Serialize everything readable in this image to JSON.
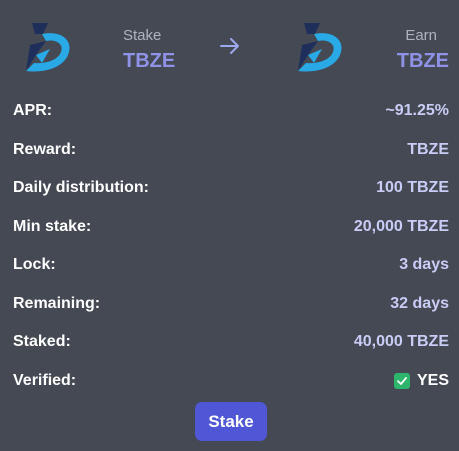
{
  "header": {
    "stake": {
      "label": "Stake",
      "symbol": "TBZE"
    },
    "earn": {
      "label": "Earn",
      "symbol": "TBZE"
    },
    "logo_icon": "tbze-logo-icon",
    "arrow_icon": "arrow-right-icon"
  },
  "details": {
    "apr": {
      "label": "APR:",
      "value": "~91.25%"
    },
    "reward": {
      "label": "Reward:",
      "value": "TBZE"
    },
    "daily_distribution": {
      "label": "Daily distribution:",
      "value": "100 TBZE"
    },
    "min_stake": {
      "label": "Min stake:",
      "value": "20,000 TBZE"
    },
    "lock": {
      "label": "Lock:",
      "value": "3 days"
    },
    "remaining": {
      "label": "Remaining:",
      "value": "32 days"
    },
    "staked": {
      "label": "Staked:",
      "value": "40,000 TBZE"
    },
    "verified": {
      "label": "Verified:",
      "value": "YES",
      "icon": "checkbox-checked-icon"
    }
  },
  "actions": {
    "stake_label": "Stake"
  },
  "colors": {
    "background": "#444953",
    "accent": "#5057d6",
    "symbol": "#8f93e8",
    "value": "#c9cdf6",
    "check": "#2db56b",
    "logo_dark": "#1f2f5c",
    "logo_light": "#29a9e6"
  }
}
